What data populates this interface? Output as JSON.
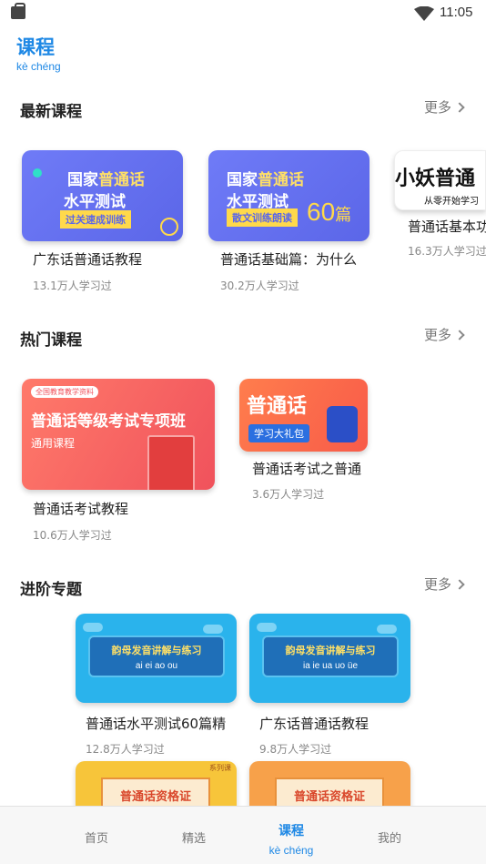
{
  "status_bar": {
    "time": "11:05"
  },
  "header": {
    "title": "课程",
    "subtitle": "kè chéng"
  },
  "sections": [
    {
      "title": "最新课程",
      "more": "更多",
      "courses": [
        {
          "thumb_line1a": "国家",
          "thumb_line1b": "普通话",
          "thumb_line2": "水平测试",
          "thumb_tag": "过关速成训练",
          "title": "广东话普通话教程",
          "learners": "13.1万人学习过"
        },
        {
          "thumb_line1a": "国家",
          "thumb_line1b": "普通话",
          "thumb_line2": "水平测试",
          "thumb_tag": "散文训练朗读",
          "thumb_big": "60",
          "thumb_big_suffix": "篇",
          "title": "普通话基础篇：为什么",
          "learners": "30.2万人学习过"
        },
        {
          "thumb_line1": "小妖普通",
          "thumb_sub": "从零开始学习",
          "title": "普通话基本功",
          "learners": "16.3万人学习过"
        }
      ]
    },
    {
      "title": "热门课程",
      "more": "更多",
      "courses": [
        {
          "thumb_top_tag": "全国教育教学资料",
          "thumb_main": "普通话等级考试专项班",
          "thumb_sub": "通用课程",
          "title": "普通话考试教程",
          "learners": "10.6万人学习过"
        },
        {
          "thumb_main": "普通话",
          "thumb_sub": "学习大礼包",
          "title": "普通话考试之普通",
          "learners": "3.6万人学习过"
        }
      ]
    },
    {
      "title": "进阶专题",
      "more": "更多",
      "courses": [
        {
          "thumb_title": "韵母发音讲解与练习",
          "thumb_sub": "ai ei ao ou",
          "title": "普通话水平测试60篇精",
          "learners": "12.8万人学习过"
        },
        {
          "thumb_title": "韵母发音讲解与练习",
          "thumb_sub": "ia ie ua uo üe",
          "title": "广东话普通话教程",
          "learners": "9.8万人学习过"
        },
        {
          "thumb_title": "普通话资格证",
          "thumb_tag": "系列课"
        },
        {
          "thumb_title": "普通话资格证"
        }
      ]
    }
  ],
  "bottom_nav": [
    {
      "label": "首页"
    },
    {
      "label": "精选"
    },
    {
      "label": "课程",
      "sub": "kè chéng",
      "active": true
    },
    {
      "label": "我的"
    }
  ],
  "colors": {
    "accent": "#1E88E5",
    "text": "#222222",
    "muted": "#888888"
  }
}
